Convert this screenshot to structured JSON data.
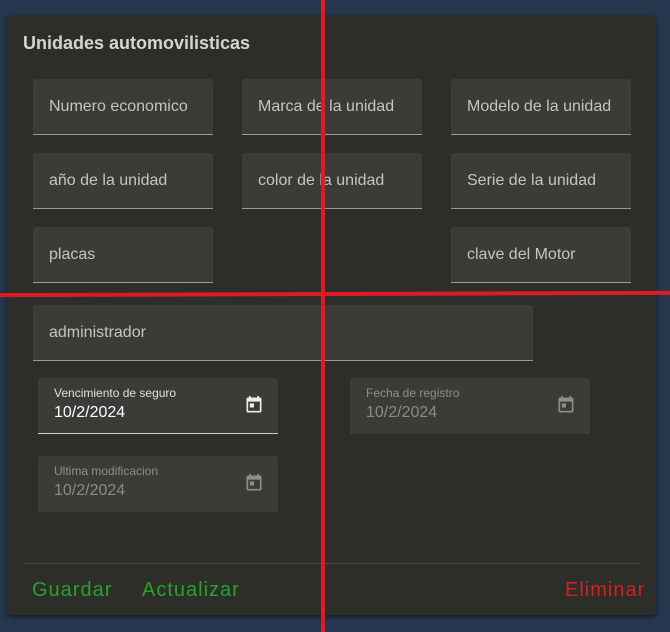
{
  "form": {
    "title": "Unidades automovilisticas",
    "fields": {
      "numero_economico": "Numero economico",
      "marca": "Marca de la unidad",
      "modelo": "Modelo de la unidad",
      "anio": "año de la unidad",
      "color": "color de la unidad",
      "serie": "Serie de la unidad",
      "placas": "placas",
      "clave_motor": "clave del Motor",
      "administrador": "administrador"
    },
    "dates": {
      "vencimiento": {
        "label": "Vencimiento de seguro",
        "value": "10/2/2024"
      },
      "registro": {
        "label": "Fecha de registro",
        "value": "10/2/2024"
      },
      "modificacion": {
        "label": "Ultima modificacion",
        "value": "10/2/2024"
      }
    },
    "actions": {
      "guardar": "Guardar",
      "actualizar": "Actualizar",
      "eliminar": "Eliminar"
    }
  },
  "colors": {
    "background": "#26374f",
    "card": "#2d2d2a",
    "field": "#3b3b38",
    "primary_action": "#27a327",
    "danger_action": "#d0221c",
    "overlay_lines": "#e01a23"
  },
  "icons": {
    "date_picker": "calendar-icon"
  }
}
